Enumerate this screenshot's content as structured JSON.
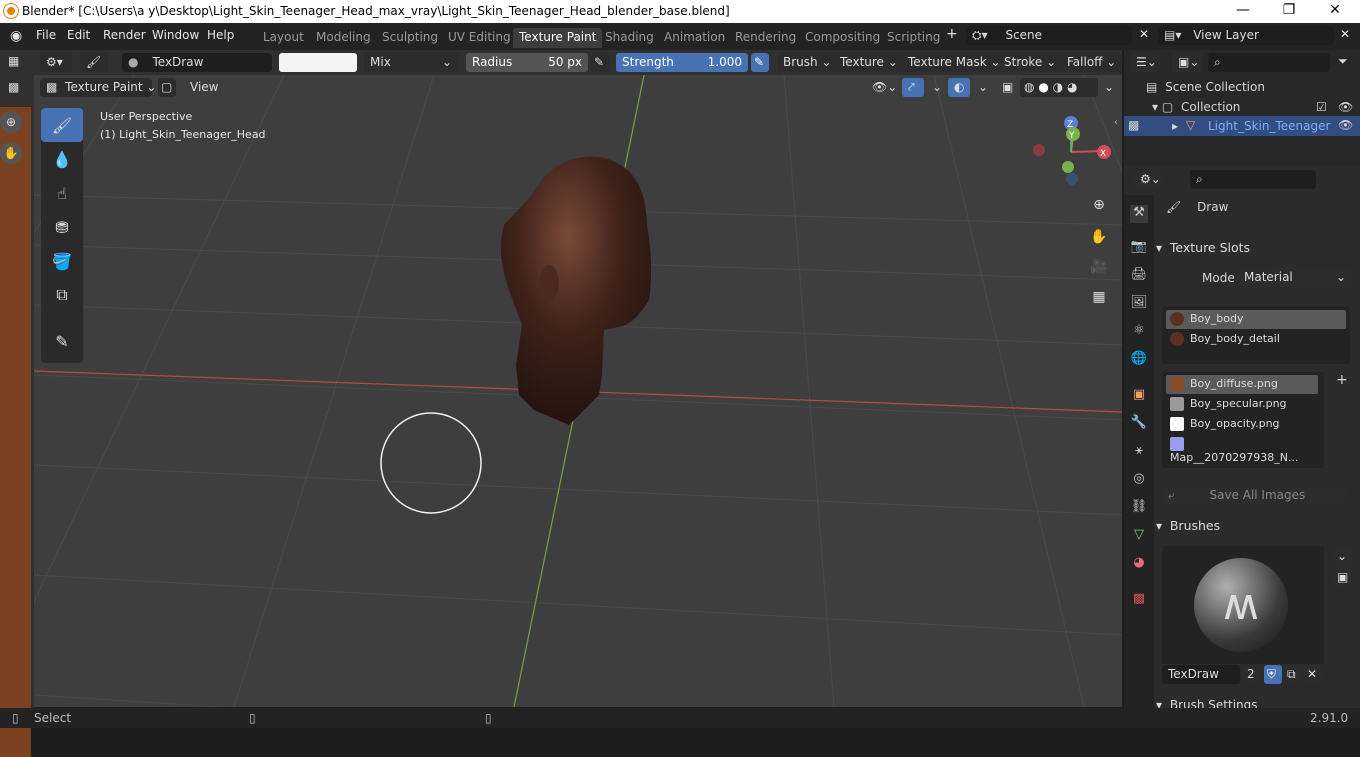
{
  "window": {
    "title": "Blender* [C:\\Users\\a y\\Desktop\\Light_Skin_Teenager_Head_max_vray\\Light_Skin_Teenager_Head_blender_base.blend]",
    "minimize": "—",
    "maximize": "❐",
    "close": "✕"
  },
  "menu": [
    "File",
    "Edit",
    "Render",
    "Window",
    "Help"
  ],
  "workspaces": [
    "Layout",
    "Modeling",
    "Sculpting",
    "UV Editing",
    "Texture Paint",
    "Shading",
    "Animation",
    "Rendering",
    "Compositing",
    "Scripting"
  ],
  "active_workspace": "Texture Paint",
  "scene": {
    "label": "Scene",
    "view_layer": "View Layer"
  },
  "toolbar": {
    "brush_name": "TexDraw",
    "blend": "Mix",
    "radius_label": "Radius",
    "radius_value": "50 px",
    "strength_label": "Strength",
    "strength_value": "1.000",
    "brush": "Brush",
    "texture": "Texture",
    "texture_mask": "Texture Mask",
    "stroke": "Stroke",
    "falloff": "Falloff"
  },
  "header": {
    "mode": "Texture Paint",
    "view": "View"
  },
  "viewport": {
    "perspective": "User Perspective",
    "object": "(1) Light_Skin_Teenager_Head",
    "axis_x": "X",
    "axis_y": "Y",
    "axis_z": "Z"
  },
  "outliner": {
    "scene_collection": "Scene Collection",
    "collection": "Collection",
    "object": "Light_Skin_Teenager"
  },
  "properties": {
    "tool": "Draw",
    "texture_slots_title": "Texture Slots",
    "mode_label": "Mode",
    "mode_value": "Material",
    "materials": [
      "Boy_body",
      "Boy_body_detail"
    ],
    "images": [
      {
        "name": "Boy_diffuse.png",
        "color": "#8a4b2a"
      },
      {
        "name": "Boy_specular.png",
        "color": "#9a9a9a"
      },
      {
        "name": "Boy_opacity.png",
        "color": "#ffffff"
      },
      {
        "name": "Map__2070297938_N...",
        "color": "#9b9bf0"
      }
    ],
    "save_all": "Save All Images",
    "brushes_title": "Brushes",
    "brush_name": "TexDraw",
    "brush_users": "2",
    "brush_settings": "Brush Settings"
  },
  "status": {
    "select": "Select",
    "version": "2.91.0"
  }
}
